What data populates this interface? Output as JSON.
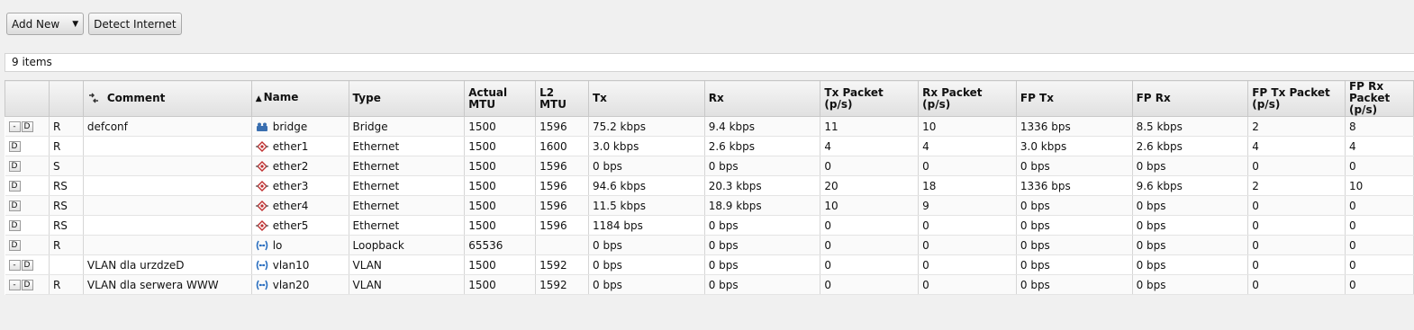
{
  "toolbar": {
    "add_new_label": "Add New",
    "add_new_caret": "▼",
    "detect_label": "Detect Internet"
  },
  "status": {
    "items_count": "9 items"
  },
  "columns": {
    "comment": "Comment",
    "name_sort": "▲",
    "name": "Name",
    "type": "Type",
    "actual_mtu": "Actual MTU",
    "l2_mtu": "L2 MTU",
    "tx": "Tx",
    "rx": "Rx",
    "tx_packet": "Tx Packet (p/s)",
    "rx_packet": "Rx Packet (p/s)",
    "fp_tx": "FP Tx",
    "fp_rx": "FP Rx",
    "fp_tx_packet": "FP Tx Packet (p/s)",
    "fp_rx_packet": "FP Rx Packet (p/s)"
  },
  "row_buttons": {
    "minus": "-",
    "disable": "D"
  },
  "rows": [
    {
      "has_minus": true,
      "flags": "R",
      "comment": "defconf",
      "icon": "bridge-icon",
      "name": "bridge",
      "type": "Bridge",
      "actual_mtu": "1500",
      "l2_mtu": "1596",
      "tx": "75.2 kbps",
      "rx": "9.4 kbps",
      "tx_packet": "11",
      "rx_packet": "10",
      "fp_tx": "1336 bps",
      "fp_rx": "8.5 kbps",
      "fp_tx_packet": "2",
      "fp_rx_packet": "8"
    },
    {
      "has_minus": false,
      "flags": "R",
      "comment": "",
      "icon": "ethernet-icon",
      "name": "ether1",
      "type": "Ethernet",
      "actual_mtu": "1500",
      "l2_mtu": "1600",
      "tx": "3.0 kbps",
      "rx": "2.6 kbps",
      "tx_packet": "4",
      "rx_packet": "4",
      "fp_tx": "3.0 kbps",
      "fp_rx": "2.6 kbps",
      "fp_tx_packet": "4",
      "fp_rx_packet": "4"
    },
    {
      "has_minus": false,
      "flags": "S",
      "comment": "",
      "icon": "ethernet-icon",
      "name": "ether2",
      "type": "Ethernet",
      "actual_mtu": "1500",
      "l2_mtu": "1596",
      "tx": "0 bps",
      "rx": "0 bps",
      "tx_packet": "0",
      "rx_packet": "0",
      "fp_tx": "0 bps",
      "fp_rx": "0 bps",
      "fp_tx_packet": "0",
      "fp_rx_packet": "0"
    },
    {
      "has_minus": false,
      "flags": "RS",
      "comment": "",
      "icon": "ethernet-icon",
      "name": "ether3",
      "type": "Ethernet",
      "actual_mtu": "1500",
      "l2_mtu": "1596",
      "tx": "94.6 kbps",
      "rx": "20.3 kbps",
      "tx_packet": "20",
      "rx_packet": "18",
      "fp_tx": "1336 bps",
      "fp_rx": "9.6 kbps",
      "fp_tx_packet": "2",
      "fp_rx_packet": "10"
    },
    {
      "has_minus": false,
      "flags": "RS",
      "comment": "",
      "icon": "ethernet-icon",
      "name": "ether4",
      "type": "Ethernet",
      "actual_mtu": "1500",
      "l2_mtu": "1596",
      "tx": "11.5 kbps",
      "rx": "18.9 kbps",
      "tx_packet": "10",
      "rx_packet": "9",
      "fp_tx": "0 bps",
      "fp_rx": "0 bps",
      "fp_tx_packet": "0",
      "fp_rx_packet": "0"
    },
    {
      "has_minus": false,
      "flags": "RS",
      "comment": "",
      "icon": "ethernet-icon",
      "name": "ether5",
      "type": "Ethernet",
      "actual_mtu": "1500",
      "l2_mtu": "1596",
      "tx": "1184 bps",
      "rx": "0 bps",
      "tx_packet": "0",
      "rx_packet": "0",
      "fp_tx": "0 bps",
      "fp_rx": "0 bps",
      "fp_tx_packet": "0",
      "fp_rx_packet": "0"
    },
    {
      "has_minus": false,
      "flags": "R",
      "comment": "",
      "icon": "vlan-icon",
      "name": "lo",
      "type": "Loopback",
      "actual_mtu": "65536",
      "l2_mtu": "",
      "tx": "0 bps",
      "rx": "0 bps",
      "tx_packet": "0",
      "rx_packet": "0",
      "fp_tx": "0 bps",
      "fp_rx": "0 bps",
      "fp_tx_packet": "0",
      "fp_rx_packet": "0"
    },
    {
      "has_minus": true,
      "flags": "",
      "comment": "VLAN dla urzdzeD",
      "icon": "vlan-icon",
      "name": "vlan10",
      "type": "VLAN",
      "actual_mtu": "1500",
      "l2_mtu": "1592",
      "tx": "0 bps",
      "rx": "0 bps",
      "tx_packet": "0",
      "rx_packet": "0",
      "fp_tx": "0 bps",
      "fp_rx": "0 bps",
      "fp_tx_packet": "0",
      "fp_rx_packet": "0"
    },
    {
      "has_minus": true,
      "flags": "R",
      "comment": "VLAN dla serwera WWW",
      "icon": "vlan-icon",
      "name": "vlan20",
      "type": "VLAN",
      "actual_mtu": "1500",
      "l2_mtu": "1592",
      "tx": "0 bps",
      "rx": "0 bps",
      "tx_packet": "0",
      "rx_packet": "0",
      "fp_tx": "0 bps",
      "fp_rx": "0 bps",
      "fp_tx_packet": "0",
      "fp_rx_packet": "0"
    }
  ]
}
